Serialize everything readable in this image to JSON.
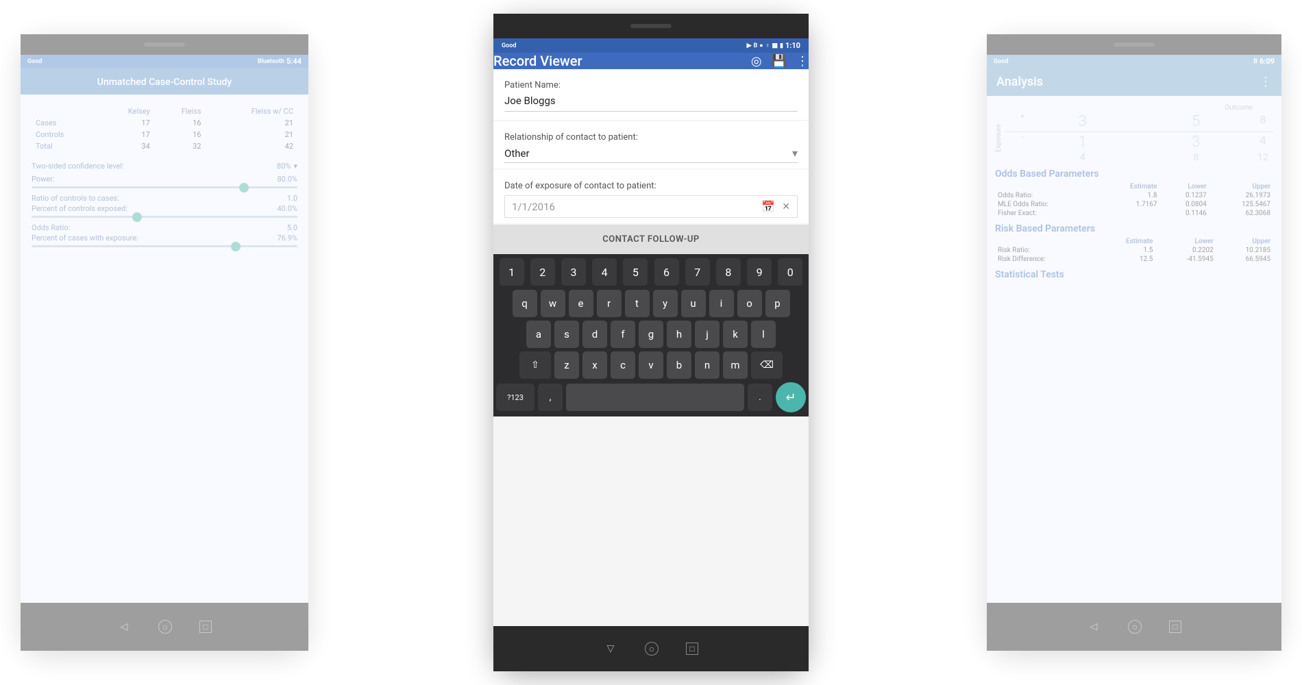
{
  "left_phone": {
    "status": {
      "left": "Good",
      "right_icons": "bluetooth clock wifi signal bars",
      "time": "5:44"
    },
    "app_title": "Unmatched Case-Control Study",
    "table": {
      "headers": [
        "",
        "Kelsey",
        "Fleiss",
        "Fleiss w/ CC"
      ],
      "rows": [
        [
          "Cases",
          "17",
          "16",
          "21"
        ],
        [
          "Controls",
          "17",
          "16",
          "21"
        ],
        [
          "Total",
          "34",
          "32",
          "42"
        ]
      ]
    },
    "confidence_label": "Two-sided confidence level:",
    "confidence_value": "80%",
    "power_label": "Power:",
    "power_value": "80.0%",
    "power_slider_pos": "78",
    "ratio_label": "Ratio of controls to cases:",
    "ratio_value": "1.0",
    "percent_controls_label": "Percent of controls exposed:",
    "percent_controls_value": "40.0%",
    "percent_controls_slider_pos": "40",
    "odds_label": "Odds Ratio:",
    "odds_value": "5.0",
    "percent_cases_label": "Percent of cases with exposure:",
    "percent_cases_value": "76.9%",
    "percent_cases_slider_pos": "77"
  },
  "center_phone": {
    "status": {
      "left": "Good",
      "right_icons": "location bluetooth clock wifi signal battery",
      "time": "1:10"
    },
    "app_title": "Record Viewer",
    "icons": [
      "target-icon",
      "save-icon",
      "more-icon"
    ],
    "form": {
      "patient_name_label": "Patient Name:",
      "patient_name_value": "Joe Bloggs",
      "relationship_label": "Relationship of contact to patient:",
      "relationship_value": "Other",
      "date_label": "Date of exposure of contact to patient:",
      "date_value": "1/1/2016",
      "contact_button": "CONTACT FOLLOW-UP"
    },
    "keyboard": {
      "number_row": [
        "1",
        "2",
        "3",
        "4",
        "5",
        "6",
        "7",
        "8",
        "9",
        "0"
      ],
      "row1": [
        "q",
        "w",
        "e",
        "r",
        "t",
        "y",
        "u",
        "i",
        "o",
        "p"
      ],
      "row2": [
        "a",
        "s",
        "d",
        "f",
        "g",
        "h",
        "j",
        "k",
        "l"
      ],
      "row3": [
        "z",
        "x",
        "c",
        "v",
        "b",
        "n",
        "m"
      ],
      "special_left": "?123",
      "special_right": "."
    }
  },
  "right_phone": {
    "status": {
      "left": "Good",
      "right_icons": "bluetooth clock wifi signal battery",
      "time": "6:09"
    },
    "app_title": "Analysis",
    "contingency": {
      "outcome_label": "Outcome",
      "plus_label": "+",
      "minus_label": "-",
      "exposure_label": "Exposure",
      "exp_plus": "+",
      "exp_minus": "-",
      "a": "3",
      "b": "5",
      "c": "8",
      "d": "1",
      "e": "3",
      "f": "4",
      "row_totals": [
        "8",
        "4"
      ],
      "col_totals": [
        "4",
        "8",
        "12"
      ]
    },
    "odds_section": {
      "title": "Odds Based Parameters",
      "headers": [
        "",
        "Estimate",
        "Lower",
        "Upper"
      ],
      "rows": [
        [
          "Odds Ratio:",
          "1.8",
          "0.1237",
          "26.1973"
        ],
        [
          "MLE Odds Ratio:",
          "1.7167",
          "0.0804",
          "125.5467"
        ],
        [
          "Fisher Exact:",
          "",
          "0.1146",
          "62.3068"
        ]
      ]
    },
    "risk_section": {
      "title": "Risk Based Parameters",
      "headers": [
        "",
        "Estimate",
        "Lower",
        "Upper"
      ],
      "rows": [
        [
          "Risk Ratio:",
          "1.5",
          "0.2202",
          "10.2185"
        ],
        [
          "Risk Difference:",
          "12.5",
          "-41.5945",
          "66.5945"
        ]
      ]
    },
    "statistical_tests_title": "Statistical Tests"
  }
}
